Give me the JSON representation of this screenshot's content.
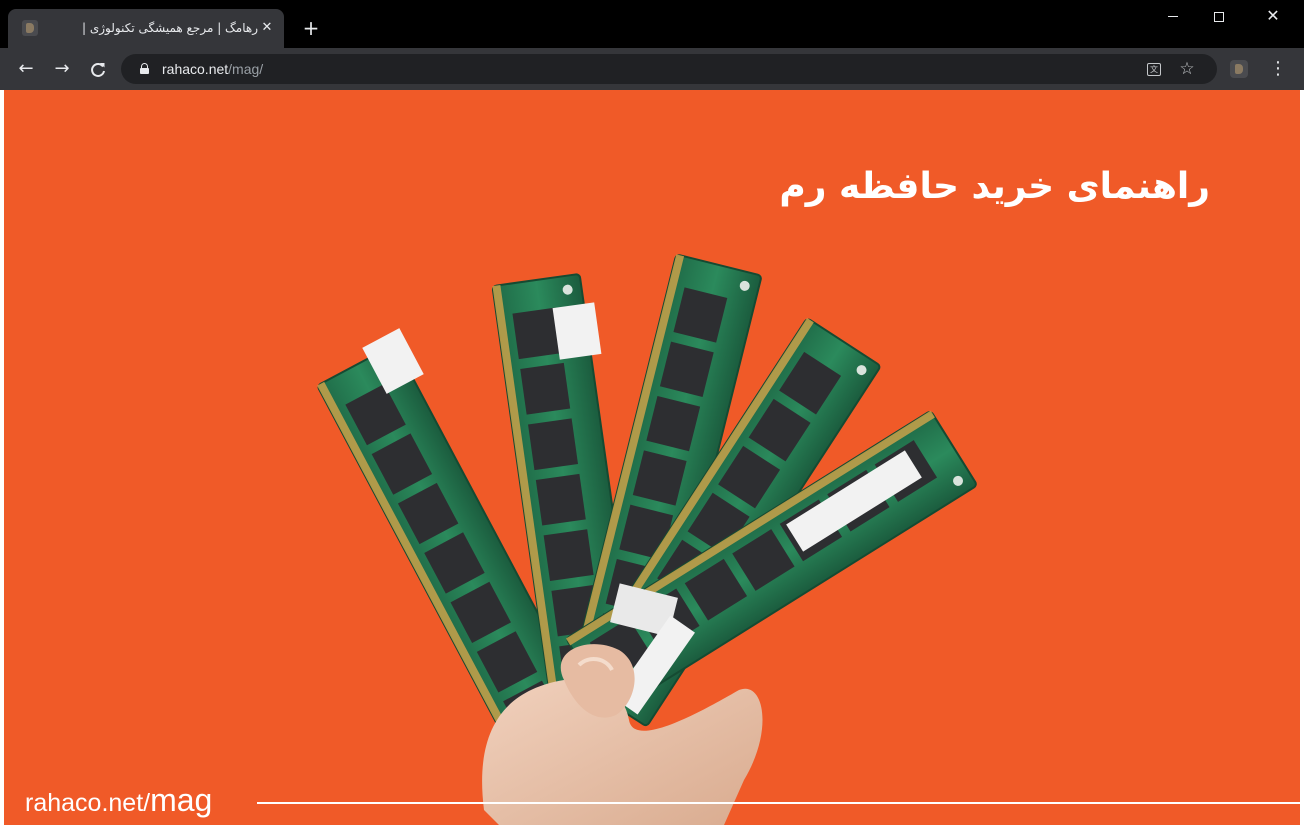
{
  "browser": {
    "tab": {
      "title": "رهامگ | مرجع همیشگی تکنولوژی |",
      "close_glyph": "✕"
    },
    "new_tab_glyph": "+",
    "window_controls": {
      "close_glyph": "✕"
    },
    "nav": {
      "back_glyph": "←",
      "forward_glyph": "→",
      "reload_glyph": "C"
    },
    "address_bar": {
      "host": "rahaco.net",
      "path": "/mag/"
    },
    "icons": {
      "translate": "translate-icon",
      "bookmark": "star-icon",
      "extension": "extension-icon",
      "menu": "more-vert-icon"
    },
    "star_glyph": "☆",
    "translate_glyph": "文",
    "menu_glyph": "⋮"
  },
  "page": {
    "background_color": "#f05a28",
    "headline": "راهنمای خرید حافظه رم",
    "footer": {
      "url_prefix": "rahaco.net/",
      "url_suffix": "mag"
    },
    "image": {
      "subject": "hand holding five RAM memory modules"
    }
  }
}
